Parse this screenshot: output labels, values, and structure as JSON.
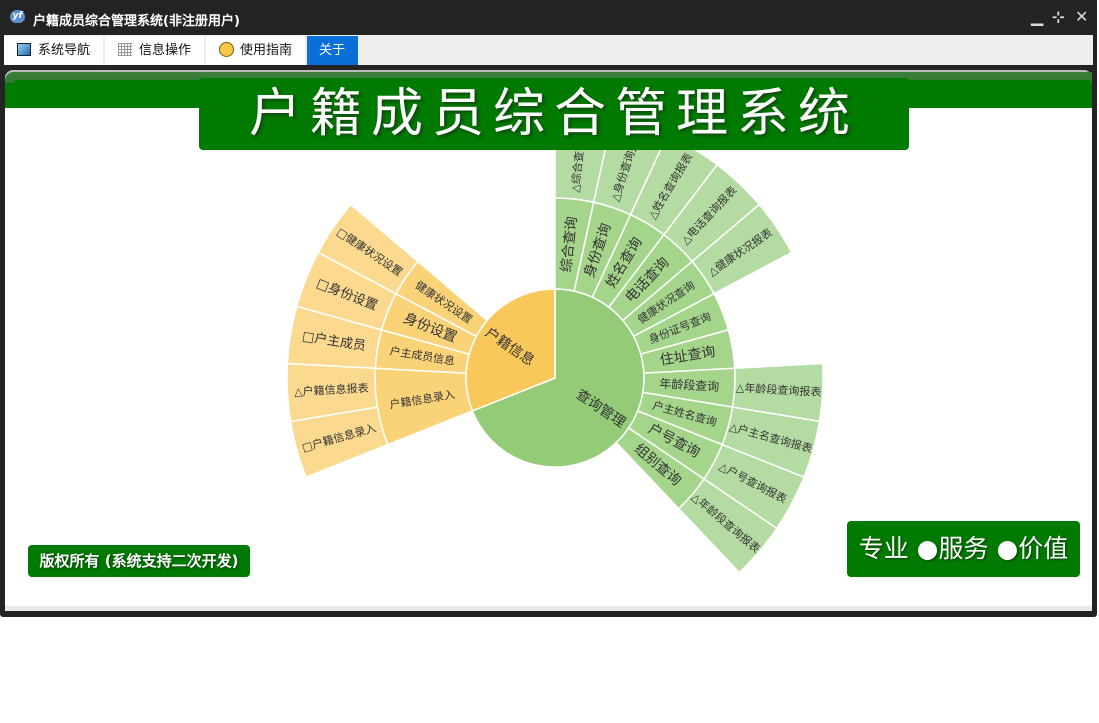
{
  "window": {
    "title": "户籍成员综合管理系统(非注册用户)",
    "app_icon": "yf-logo-icon",
    "controls": [
      "minimize-icon",
      "restore-icon",
      "close-icon"
    ]
  },
  "tabs": [
    {
      "label": "系统导航",
      "icon": "monitor-icon"
    },
    {
      "label": "信息操作",
      "icon": "grid-icon"
    },
    {
      "label": "使用指南",
      "icon": "help-icon"
    },
    {
      "label": "关于",
      "active": true
    }
  ],
  "banner": {
    "title": "户籍成员综合管理系统"
  },
  "footer": {
    "copyright": "版权所有 (系统支持二次开发)",
    "slogan": "专业 ●服务 ●价值"
  },
  "colors": {
    "green_l1": "#93cb76",
    "green_l2": "#a4d58b",
    "green_l3": "#b4dca2",
    "yellow_l1": "#f9c85b",
    "yellow_l2": "#fad379",
    "yellow_l3": "#fbd98e",
    "brand_green": "#007a00",
    "tab_active": "#0b6fd8"
  },
  "chart_data": {
    "type": "sunburst",
    "start": "top, clockwise",
    "tree": [
      {
        "name": "查询管理",
        "value": 20,
        "color": "green",
        "children": [
          {
            "name": "综合查询",
            "value": 1,
            "children": [
              {
                "name": "△综合查询报表",
                "value": 1
              }
            ]
          },
          {
            "name": "身份查询",
            "value": 1,
            "children": [
              {
                "name": "△身份查询报表",
                "value": 1
              }
            ]
          },
          {
            "name": "姓名查询",
            "value": 1,
            "children": [
              {
                "name": "△姓名查询报表",
                "value": 1
              }
            ]
          },
          {
            "name": "电话查询",
            "value": 1,
            "children": [
              {
                "name": "△电话查询报表",
                "value": 1
              }
            ]
          },
          {
            "name": "健康状况查询",
            "value": 1,
            "children": [
              {
                "name": "△健康状况报表",
                "value": 1
              }
            ]
          },
          {
            "name": "身份证号查询",
            "value": 1
          },
          {
            "name": "住址查询",
            "value": 1
          },
          {
            "name": "年龄段查询",
            "value": 1,
            "children": [
              {
                "name": "△年龄段查询报表",
                "value": 1
              }
            ]
          },
          {
            "name": "户主姓名查询",
            "value": 1,
            "children": [
              {
                "name": "△户主名查询报表",
                "value": 1
              }
            ]
          },
          {
            "name": "户号查询",
            "value": 1,
            "children": [
              {
                "name": "△户号查询报表",
                "value": 1
              }
            ]
          },
          {
            "name": "组别查询",
            "value": 1,
            "children": [
              {
                "name": "△年龄段查询报表",
                "value": 1
              }
            ]
          }
        ]
      },
      {
        "name": "户籍信息",
        "value": 9,
        "color": "yellow",
        "children": [
          {
            "name": "户籍信息录入",
            "value": 2,
            "children": [
              {
                "name": "□户籍信息录入",
                "value": 1
              },
              {
                "name": "△户籍信息报表",
                "value": 1
              }
            ]
          },
          {
            "name": "户主成员信息",
            "value": 1,
            "children": [
              {
                "name": "□户主成员",
                "value": 1
              }
            ]
          },
          {
            "name": "身份设置",
            "value": 1,
            "children": [
              {
                "name": "□身份设置",
                "value": 1
              }
            ]
          },
          {
            "name": "健康状况设置",
            "value": 1,
            "children": [
              {
                "name": "□健康状况设置",
                "value": 1
              }
            ]
          }
        ]
      }
    ]
  }
}
